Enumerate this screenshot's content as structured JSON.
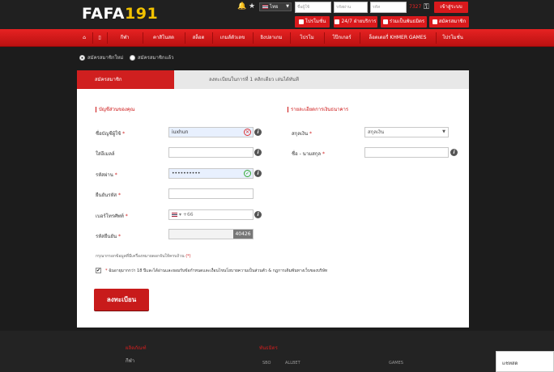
{
  "header": {
    "logo_main": "FAFA",
    "logo_num": "191",
    "bell_glyph": "🔔",
    "star_glyph": "★",
    "lang_label": "ไทย",
    "username_placeholder": "ชื่อผู้ใช้",
    "password_placeholder": "รหัสผ่าน",
    "code_placeholder": "รหัส",
    "captcha_code": "7327",
    "login_label": "เข้าสู่ระบบ",
    "promotions_label": "โปรโมชั่น",
    "support_label": "24/7 ฝ่ายบริการ",
    "affiliate_label": "ร่วมเป็นพันธมิตร",
    "register_label": "สมัครสมาชิก"
  },
  "nav": {
    "home_glyph": "⌂",
    "mobile_glyph": "▯",
    "items": [
      "กีฬา",
      "คาสิโนสด",
      "สล็อต",
      "เกมส์ตัวเลข",
      "ยิงปลาเกม",
      "โปรโม",
      "โป๊กเกอร์",
      "ล็อตเตอรี่ KHMER GAMES",
      "โปรโมชั่น"
    ]
  },
  "radios": {
    "option_new": "สมัครสมาชิกใหม่",
    "option_existing": "สมัครสมาชิกแล้ว"
  },
  "tabs": {
    "active": "สมัครสมาชิก",
    "other": "ลงทะเบียนในการที่ 1 คลิกเดียว เล่นได้ทันที"
  },
  "form": {
    "account_section": "บัญชีส่วนของคุณ",
    "banking_section": "รายละเอียดการเงินธนาคาร",
    "username_label": "ชื่อบัญชีผู้ใช้",
    "username_value": "iuxhun",
    "email_label": "ใส่อีเมลล์",
    "password_label": "รหัสผ่าน",
    "password_value": "••••••••••",
    "confirm_label": "ยืนยันรหัส",
    "phone_label": "เบอร์โทรศัพท์",
    "phone_code": "+66",
    "captcha_label": "รหัสยืนยัน",
    "captcha_value": "40426",
    "currency_label": "สกุลเงิน",
    "currency_value": "สกุลเงิน",
    "fullname_label": "ชื่อ - นามสกุล",
    "required_mark": "*",
    "note_text": "กรุณากรอกข้อมูลที่มีเครื่องหมายดอกจันให้ครบถ้วน",
    "note_mark": "(*)",
    "check_glyph": "✔",
    "terms_text": "ฉันอายุมากกว่า 18 ปีและได้อ่านและยอมรับข้อกำหนดและเงื่อนไขนโยบายความเป็นส่วนตัว & กฎการเดิมพันทางเว็บของบริษัท",
    "submit_label": "ลงทะเบียน",
    "info_glyph": "i",
    "error_glyph": "✕",
    "ok_glyph": "✓"
  },
  "footer": {
    "col1_heading": "ผลิตภัณฑ์",
    "col1_item": "กีฬา",
    "col2_heading": "พันธมิตร",
    "partner_logos": [
      "SBO",
      "ALLBET",
      "",
      "",
      "",
      "",
      "GAMES"
    ]
  },
  "chat": {
    "label": "แชทสด"
  }
}
